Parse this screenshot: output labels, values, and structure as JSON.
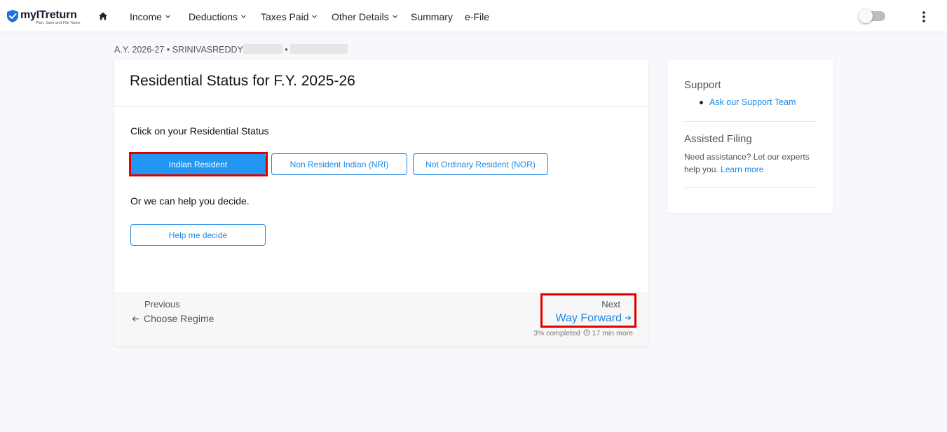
{
  "header": {
    "brand": "myITreturn",
    "tagline": "Plan, Save and File Taxes",
    "nav": [
      {
        "label": "Income",
        "dropdown": true
      },
      {
        "label": "Deductions",
        "dropdown": true
      },
      {
        "label": "Taxes Paid",
        "dropdown": true
      },
      {
        "label": "Other Details",
        "dropdown": true
      },
      {
        "label": "Summary",
        "dropdown": false
      },
      {
        "label": "e-File",
        "dropdown": false
      }
    ],
    "theme_toggle": "off",
    "brand_color": "#1e6fe0"
  },
  "breadcrumb": {
    "assessment_year": "A.Y. 2026-27",
    "separator": "•",
    "user_name": "SRINIVASREDDY"
  },
  "main": {
    "title": "Residential Status for F.Y. 2025-26",
    "prompt": "Click on your Residential Status",
    "options": [
      {
        "label": "Indian Resident",
        "selected": true
      },
      {
        "label": "Non Resident Indian (NRI)",
        "selected": false
      },
      {
        "label": "Not Ordinary Resident (NOR)",
        "selected": false
      }
    ],
    "or_text": "Or we can help you decide.",
    "help_button": "Help me decide",
    "footer": {
      "previous_label": "Previous",
      "previous_link": "Choose Regime",
      "next_label": "Next",
      "next_link": "Way Forward",
      "progress_text": "3% completed",
      "time_left": "17 min more"
    },
    "accent_color": "#1e88e5",
    "highlight_color": "#e00000"
  },
  "sidebar": {
    "support_heading": "Support",
    "support_link": "Ask our Support Team",
    "assisted_heading": "Assisted Filing",
    "assisted_text": "Need assistance? Let our experts help you.",
    "assisted_link": "Learn more"
  }
}
